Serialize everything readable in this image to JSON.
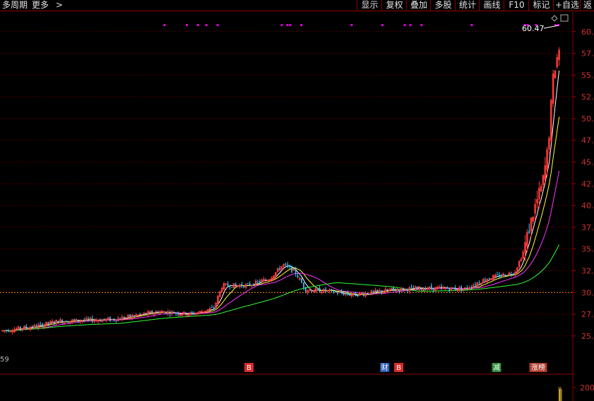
{
  "toolbar": {
    "multi_period": "多周期",
    "more": "更多",
    "more_arrow": ">",
    "buttons": [
      "显示",
      "复权",
      "叠加",
      "多股",
      "统计",
      "画线",
      "F10",
      "标记",
      "+自选",
      "返"
    ]
  },
  "chart_data": {
    "type": "candlestick",
    "y_axis": {
      "ticks": [
        "60.",
        "57.",
        "55.",
        "52.",
        "50.",
        "47.",
        "45.",
        "42.",
        "40.",
        "37.",
        "35.",
        "32.",
        "30.",
        "27.",
        "25."
      ],
      "tick_values": [
        60,
        57.5,
        55,
        52.5,
        50,
        47.5,
        45,
        42.5,
        40,
        37.5,
        35,
        32.5,
        30,
        27.5,
        25
      ],
      "range": [
        23.2,
        61.2
      ],
      "grid": "dotted-red"
    },
    "reference_price": 30.0,
    "max_label": "60.47",
    "max_value": 60.47,
    "left_edge_label": "59",
    "volume_axis_label": "200",
    "markers": [
      {
        "text": "B",
        "color": "#d62b2b",
        "pos": 0.435
      },
      {
        "text": "财",
        "color": "#2a5db8",
        "pos": 0.678
      },
      {
        "text": "B",
        "color": "#d62b2b",
        "pos": 0.703
      },
      {
        "text": "减",
        "color": "#2e8b3a",
        "pos": 0.878
      },
      {
        "text": "涨榜",
        "color": "#b03a2a",
        "pos": 0.945
      }
    ],
    "colors": {
      "up": "#ff3b3b",
      "down": "#33ccff",
      "ma5": "#ffffff",
      "ma10": "#ffff33",
      "ma20": "#ff33ff",
      "ma60": "#33ff33",
      "grid": "#b00000",
      "event_dots": "#e000e0"
    }
  }
}
